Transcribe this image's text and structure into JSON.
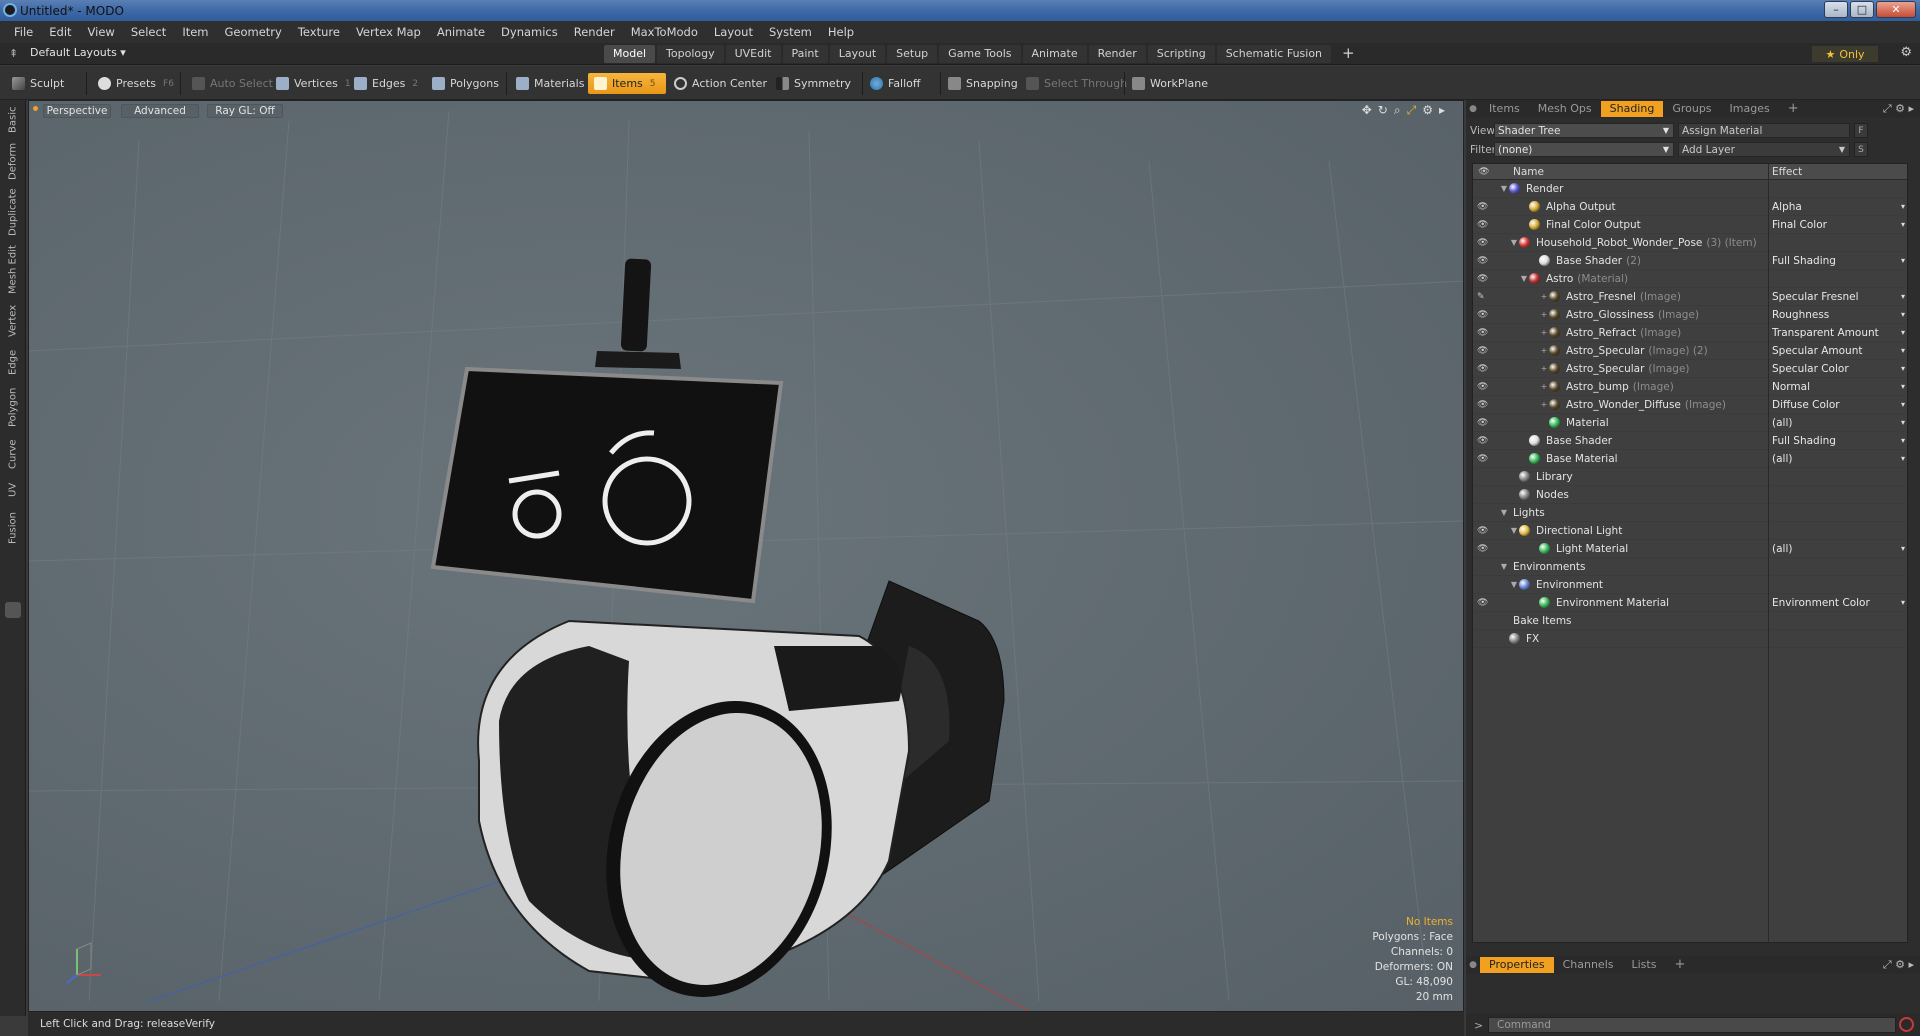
{
  "window": {
    "title": "Untitled* - MODO",
    "min": "–",
    "max": "□",
    "close": "✕"
  },
  "menu": [
    "File",
    "Edit",
    "View",
    "Select",
    "Item",
    "Geometry",
    "Texture",
    "Vertex Map",
    "Animate",
    "Dynamics",
    "Render",
    "MaxToModo",
    "Layout",
    "System",
    "Help"
  ],
  "layouts": {
    "dropdown": "Default Layouts ▾",
    "tabs": [
      "Model",
      "Topology",
      "UVEdit",
      "Paint",
      "Layout",
      "Setup",
      "Game Tools",
      "Animate",
      "Render",
      "Scripting",
      "Schematic Fusion"
    ],
    "active": "Model",
    "add": "+",
    "only": "Only",
    "star": "★"
  },
  "toolbar": {
    "sculpt": "Sculpt",
    "presets": "Presets",
    "presets_key": "F6",
    "auto_select": "Auto Select",
    "vertices": "Vertices",
    "vertices_key": "1",
    "edges": "Edges",
    "edges_key": "2",
    "polygons": "Polygons",
    "materials": "Materials",
    "items": "Items",
    "items_key": "5",
    "action_center": "Action Center",
    "symmetry": "Symmetry",
    "falloff": "Falloff",
    "snapping": "Snapping",
    "select_through": "Select Through",
    "workplane": "WorkPlane"
  },
  "left_tabs": [
    "Basic",
    "Deform",
    "Duplicate",
    "Mesh Edit",
    "Vertex",
    "Edge",
    "Polygon",
    "Curve",
    "UV",
    "Fusion"
  ],
  "viewport": {
    "perspective": "Perspective",
    "advanced": "Advanced",
    "raygl": "Ray GL: Off",
    "stats": {
      "selection": "No Items",
      "polygons": "Polygons : Face",
      "channels": "Channels: 0",
      "deformers": "Deformers: ON",
      "gl": "GL: 48,090",
      "scale": "20 mm"
    }
  },
  "status": "Left Click and Drag:  releaseVerify",
  "panel": {
    "tabs": [
      "Items",
      "Mesh Ops",
      "Shading",
      "Groups",
      "Images"
    ],
    "active": "Shading",
    "add": "+",
    "view_label": "View",
    "view_value": "Shader Tree",
    "assign_material": "Assign Material",
    "f_btn": "F",
    "filter_label": "Filter",
    "filter_value": "(none)",
    "add_layer": "Add Layer",
    "s_btn": "S",
    "col_name": "Name",
    "col_effect": "Effect",
    "rows": [
      {
        "indent": 0,
        "tw": "▼",
        "eye": "",
        "icon": "#5b5bd0",
        "name": "Render",
        "sub": "",
        "effect": "",
        "drop": ""
      },
      {
        "indent": 2,
        "tw": "",
        "eye": "👁",
        "icon": "#d8b13a",
        "name": "Alpha Output",
        "sub": "",
        "effect": "Alpha",
        "drop": "▾"
      },
      {
        "indent": 2,
        "tw": "",
        "eye": "👁",
        "icon": "#d8b13a",
        "name": "Final Color Output",
        "sub": "",
        "effect": "Final Color",
        "drop": "▾"
      },
      {
        "indent": 1,
        "tw": "▼",
        "eye": "👁",
        "icon": "#d83a3a",
        "name": "Household_Robot_Wonder_Pose",
        "sub": "(3) (Item)",
        "effect": "",
        "drop": ""
      },
      {
        "indent": 3,
        "tw": "",
        "eye": "👁",
        "icon": "#e0e0e0",
        "name": "Base Shader",
        "sub": "(2)",
        "effect": "Full Shading",
        "drop": "▾"
      },
      {
        "indent": 2,
        "tw": "▼",
        "eye": "👁",
        "icon": "#c43434",
        "name": "Astro",
        "sub": "(Material)",
        "effect": "",
        "drop": ""
      },
      {
        "indent": 4,
        "tw": "+",
        "eye": "✎",
        "icon": "#5a4a2a",
        "name": "Astro_Fresnel",
        "sub": "(Image)",
        "effect": "Specular Fresnel",
        "drop": "▾"
      },
      {
        "indent": 4,
        "tw": "+",
        "eye": "👁",
        "icon": "#5a4a2a",
        "name": "Astro_Glossiness",
        "sub": "(Image)",
        "effect": "Roughness",
        "drop": "▾"
      },
      {
        "indent": 4,
        "tw": "+",
        "eye": "👁",
        "icon": "#5a4a2a",
        "name": "Astro_Refract",
        "sub": "(Image)",
        "effect": "Transparent Amount",
        "drop": "▾"
      },
      {
        "indent": 4,
        "tw": "+",
        "eye": "👁",
        "icon": "#5a4a2a",
        "name": "Astro_Specular",
        "sub": "(Image) (2)",
        "effect": "Specular Amount",
        "drop": "▾"
      },
      {
        "indent": 4,
        "tw": "+",
        "eye": "👁",
        "icon": "#5a4a2a",
        "name": "Astro_Specular",
        "sub": "(Image)",
        "effect": "Specular Color",
        "drop": "▾"
      },
      {
        "indent": 4,
        "tw": "+",
        "eye": "👁",
        "icon": "#5a4a2a",
        "name": "Astro_bump",
        "sub": "(Image)",
        "effect": "Normal",
        "drop": "▾"
      },
      {
        "indent": 4,
        "tw": "+",
        "eye": "👁",
        "icon": "#5a4a2a",
        "name": "Astro_Wonder_Diffuse",
        "sub": "(Image)",
        "effect": "Diffuse Color",
        "drop": "▾"
      },
      {
        "indent": 4,
        "tw": "",
        "eye": "👁",
        "icon": "#3fbf5f",
        "name": "Material",
        "sub": "",
        "effect": "(all)",
        "drop": "▾"
      },
      {
        "indent": 2,
        "tw": "",
        "eye": "👁",
        "icon": "#e0e0e0",
        "name": "Base Shader",
        "sub": "",
        "effect": "Full Shading",
        "drop": "▾"
      },
      {
        "indent": 2,
        "tw": "",
        "eye": "👁",
        "icon": "#3fbf5f",
        "name": "Base Material",
        "sub": "",
        "effect": "(all)",
        "drop": "▾"
      },
      {
        "indent": 1,
        "tw": "",
        "eye": "",
        "icon": "#8a8a8a",
        "name": "Library",
        "sub": "",
        "effect": "",
        "drop": ""
      },
      {
        "indent": 1,
        "tw": "",
        "eye": "",
        "icon": "#8a8a8a",
        "name": "Nodes",
        "sub": "",
        "effect": "",
        "drop": ""
      },
      {
        "indent": 0,
        "tw": "▼",
        "eye": "",
        "icon": "",
        "name": "Lights",
        "sub": "",
        "effect": "",
        "drop": ""
      },
      {
        "indent": 1,
        "tw": "▼",
        "eye": "👁",
        "icon": "#e8c14a",
        "name": "Directional Light",
        "sub": "",
        "effect": "",
        "drop": ""
      },
      {
        "indent": 3,
        "tw": "",
        "eye": "👁",
        "icon": "#3fbf5f",
        "name": "Light Material",
        "sub": "",
        "effect": "(all)",
        "drop": "▾"
      },
      {
        "indent": 0,
        "tw": "▼",
        "eye": "",
        "icon": "",
        "name": "Environments",
        "sub": "",
        "effect": "",
        "drop": ""
      },
      {
        "indent": 1,
        "tw": "▼",
        "eye": "",
        "icon": "#6a8ad8",
        "name": "Environment",
        "sub": "",
        "effect": "",
        "drop": ""
      },
      {
        "indent": 3,
        "tw": "",
        "eye": "👁",
        "icon": "#3fbf5f",
        "name": "Environment Material",
        "sub": "",
        "effect": "Environment Color",
        "drop": "▾"
      },
      {
        "indent": 0,
        "tw": "",
        "eye": "",
        "icon": "",
        "name": "Bake Items",
        "sub": "",
        "effect": "",
        "drop": ""
      },
      {
        "indent": 0,
        "tw": "",
        "eye": "",
        "icon": "#8a8a8a",
        "name": "FX",
        "sub": "",
        "effect": "",
        "drop": ""
      }
    ],
    "bottom_tabs": [
      "Properties",
      "Channels",
      "Lists"
    ],
    "bottom_active": "Properties",
    "command_placeholder": "Command",
    "prompt": ">"
  }
}
